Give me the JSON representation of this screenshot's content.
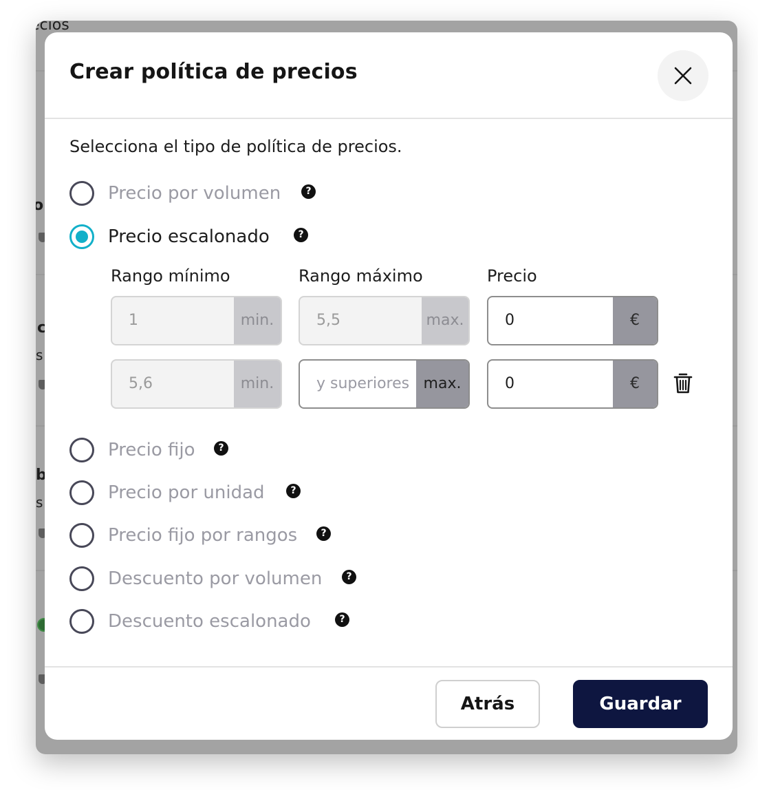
{
  "background": {
    "fragments": [
      "ecios",
      "o",
      "c",
      "s",
      "b",
      "s"
    ]
  },
  "modal": {
    "title": "Crear política de precios",
    "subtitle": "Selecciona el tipo de política de precios.",
    "close_icon": "close-icon",
    "help_icon": "question-circle-icon",
    "options": [
      {
        "label": "Precio por volumen",
        "selected": false
      },
      {
        "label": "Precio escalonado",
        "selected": true
      },
      {
        "label": "Precio fijo",
        "selected": false
      },
      {
        "label": "Precio por unidad",
        "selected": false
      },
      {
        "label": "Precio fijo por rangos",
        "selected": false
      },
      {
        "label": "Descuento por volumen",
        "selected": false
      },
      {
        "label": "Descuento escalonado",
        "selected": false
      }
    ],
    "tiers": {
      "headers": {
        "min": "Rango mínimo",
        "max": "Rango máximo",
        "price": "Precio"
      },
      "rows": [
        {
          "min": "1",
          "min_suffix": "min.",
          "max": "5,5",
          "max_suffix": "max.",
          "price": "0",
          "currency": "€"
        },
        {
          "min": "5,6",
          "min_suffix": "min.",
          "max_placeholder": "y superiores",
          "max_suffix": "max.",
          "price": "0",
          "currency": "€",
          "delete_icon": "trash-icon"
        }
      ]
    },
    "buttons": {
      "back": "Atrás",
      "save": "Guardar"
    },
    "colors": {
      "accent": "#12b0c9",
      "primary": "#0e1640"
    }
  }
}
